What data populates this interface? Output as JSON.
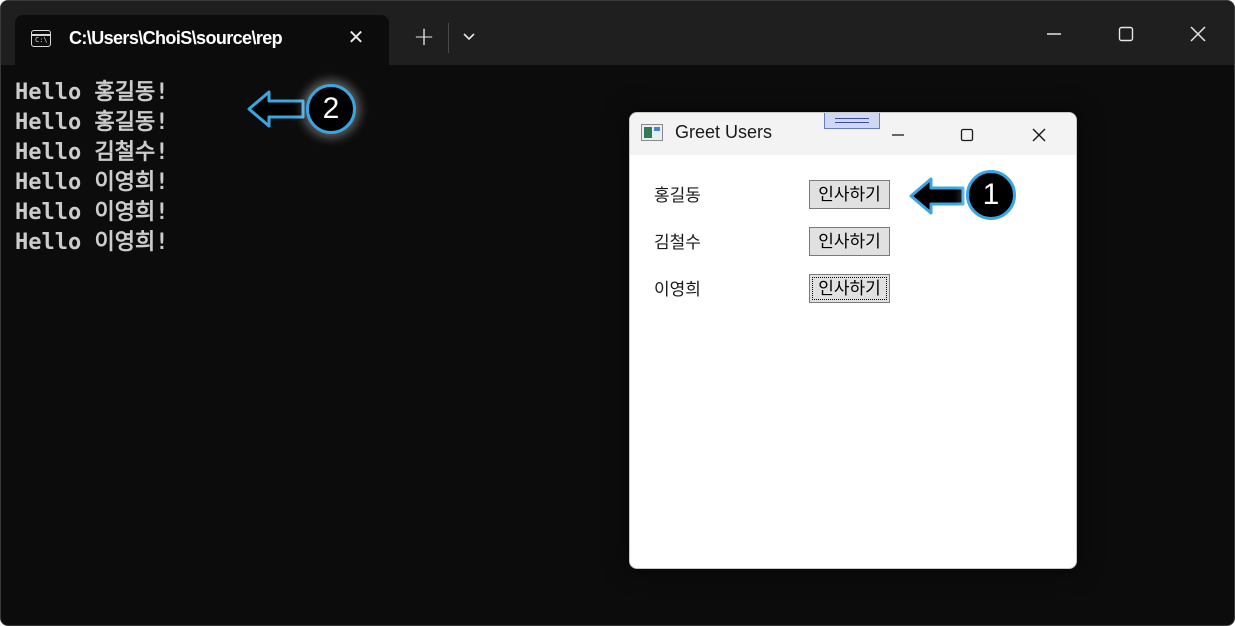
{
  "terminal": {
    "tab_title": "C:\\Users\\ChoiS\\source\\rep",
    "tab_icon_text": "C:\\",
    "new_tab_label": "+",
    "output_lines": [
      "Hello 홍길동!",
      "Hello 홍길동!",
      "Hello 김철수!",
      "Hello 이영희!",
      "Hello 이영희!",
      "Hello 이영희!"
    ]
  },
  "dialog": {
    "title": "Greet Users",
    "users": [
      {
        "name": "홍길동",
        "button_label": "인사하기"
      },
      {
        "name": "김철수",
        "button_label": "인사하기"
      },
      {
        "name": "이영희",
        "button_label": "인사하기"
      }
    ]
  },
  "callouts": [
    {
      "label": "1"
    },
    {
      "label": "2"
    }
  ],
  "colors": {
    "terminal_bg": "#0c0c0c",
    "callout_border": "#3aa5e0",
    "button_bg": "#e1e1e1"
  }
}
